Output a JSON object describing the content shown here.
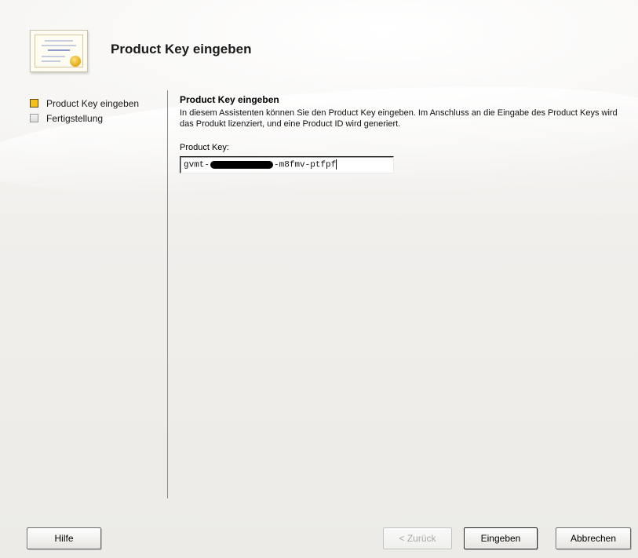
{
  "header": {
    "title": "Product Key eingeben"
  },
  "steps": [
    {
      "label": "Product Key eingeben",
      "state": "current"
    },
    {
      "label": "Fertigstellung",
      "state": "pending"
    }
  ],
  "content": {
    "heading": "Product Key eingeben",
    "description": "In diesem Assistenten können Sie den Product Key eingeben. Im Anschluss an die Eingabe des Product Keys wird das Produkt lizenziert, und eine Product ID wird generiert.",
    "key_label": "Product Key:",
    "key_prefix": "gvmt-",
    "key_suffix": "-m8fmv-ptfpf"
  },
  "buttons": {
    "help": "Hilfe",
    "back": "< Zurück",
    "submit": "Eingeben",
    "cancel": "Abbrechen"
  },
  "colors": {
    "active_step": "#f3c21a",
    "divider": "#8d8d8d"
  }
}
